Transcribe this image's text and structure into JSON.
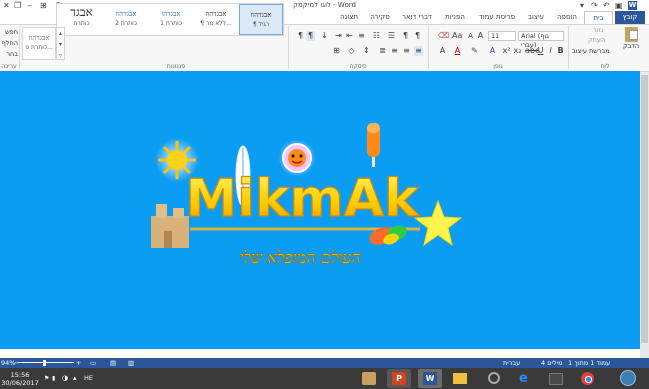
{
  "window": {
    "title": "לוגו למיקמק - Word",
    "help": "?",
    "minimize": "‒",
    "restore": "❐",
    "close": "✕"
  },
  "tabs": {
    "file": "קובץ",
    "items": [
      "בית",
      "הוספה",
      "עיצוב",
      "פריסת עמוד",
      "הפניות",
      "דברי דואר",
      "סקירה",
      "תצוגה"
    ]
  },
  "ribbon": {
    "clipboard": {
      "paste": "הדבק",
      "cut": "גזור",
      "copy": "העתק",
      "format_painter": "מברשת עיצוב",
      "label": "לוח"
    },
    "font": {
      "name": "Arial (גוף עברי)",
      "size": "11",
      "label": "גופן"
    },
    "paragraph": {
      "label": "פיסקה"
    },
    "styles": {
      "label": "סגנונות",
      "items": [
        {
          "sample": "אבגדהוז",
          "name": "¶ רגיל",
          "selected": true
        },
        {
          "sample": "אבגדהוז",
          "name": "¶ ללא מר...",
          "selected": false
        },
        {
          "sample": "אבגדהו",
          "name": "כותרת 1",
          "selected": false
        },
        {
          "sample": "אבגדהוז",
          "name": "כותרת 2",
          "selected": false
        },
        {
          "sample": "אבגד",
          "name": "כותרת",
          "selected": false
        },
        {
          "sample": "אבגדהוז",
          "name": "כותרת ט...",
          "selected": false
        }
      ]
    },
    "editing": {
      "find": "חפש",
      "replace": "החלף",
      "select": "בחר",
      "label": "עריכה"
    }
  },
  "document": {
    "logo_title": "MikmAk",
    "logo_subtitle": "העולם המופלא שלי",
    "page_color": "#0b9df3"
  },
  "status": {
    "page": "עמוד 1 מתוך 1",
    "words": "4 מילים",
    "language": "עברית",
    "zoom": "94%"
  },
  "taskbar": {
    "time": "15:56",
    "date": "30/06/2017",
    "lang": "HE"
  }
}
